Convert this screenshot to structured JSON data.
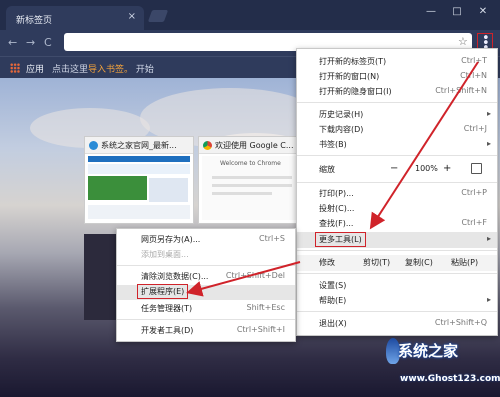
{
  "tab": {
    "title": "新标签页",
    "close_glyph": "×"
  },
  "window_controls": {
    "minimize": "—",
    "maximize": "□",
    "close": "✕"
  },
  "toolbar": {
    "back_glyph": "←",
    "forward_glyph": "→",
    "reload_glyph": "C",
    "star_glyph": "☆",
    "menu_glyph": "⋮"
  },
  "bookmarks": {
    "apps_label": "应用",
    "import_prefix": "点击这里",
    "import_link": "导入书签。",
    "import_suffix": " 开始"
  },
  "thumbnails": [
    {
      "title": "系统之家官网_最新...",
      "favicon_color": "#2a8bd6"
    },
    {
      "title": "欢迎使用 Google C...",
      "favicon_color": "#db4437",
      "welcome_text": "Welcome to Chrome"
    }
  ],
  "menu": {
    "new_tab": {
      "label": "打开新的标签页(T)",
      "shortcut": "Ctrl+T"
    },
    "new_window": {
      "label": "打开新的窗口(N)",
      "shortcut": "Ctrl+N"
    },
    "new_incognito": {
      "label": "打开新的隐身窗口(I)",
      "shortcut": "Ctrl+Shift+N"
    },
    "history": {
      "label": "历史记录(H)",
      "arrow": "▸"
    },
    "downloads": {
      "label": "下载内容(D)",
      "shortcut": "Ctrl+J"
    },
    "bookmarks": {
      "label": "书签(B)",
      "arrow": "▸"
    },
    "zoom": {
      "label": "缩放",
      "minus": "−",
      "value": "100%",
      "plus": "+"
    },
    "print": {
      "label": "打印(P)...",
      "shortcut": "Ctrl+P"
    },
    "cast": {
      "label": "投射(C)..."
    },
    "find": {
      "label": "查找(F)...",
      "shortcut": "Ctrl+F"
    },
    "more_tools": {
      "label": "更多工具(L)",
      "arrow": "▸"
    },
    "edit": {
      "label": "修改",
      "cut": "剪切(T)",
      "copy": "复制(C)",
      "paste": "粘贴(P)"
    },
    "settings": {
      "label": "设置(S)"
    },
    "help": {
      "label": "帮助(E)",
      "arrow": "▸"
    },
    "exit": {
      "label": "退出(X)",
      "shortcut": "Ctrl+Shift+Q"
    }
  },
  "submenu": {
    "save_page": {
      "label": "网页另存为(A)...",
      "shortcut": "Ctrl+S"
    },
    "add_desktop": {
      "label": "添加到桌面..."
    },
    "clear_data": {
      "label": "清除浏览数据(C)...",
      "shortcut": "Ctrl+Shift+Del"
    },
    "extensions": {
      "label": "扩展程序(E)"
    },
    "task_manager": {
      "label": "任务管理器(T)",
      "shortcut": "Shift+Esc"
    },
    "dev_tools": {
      "label": "开发者工具(D)",
      "shortcut": "Ctrl+Shift+I"
    }
  },
  "watermark": {
    "logo": "系统之家",
    "url": "www.Ghost123.com"
  },
  "colors": {
    "accent_red": "#d0232a",
    "chrome_dark": "#232d4a",
    "toolbar": "#2f3b5c"
  }
}
